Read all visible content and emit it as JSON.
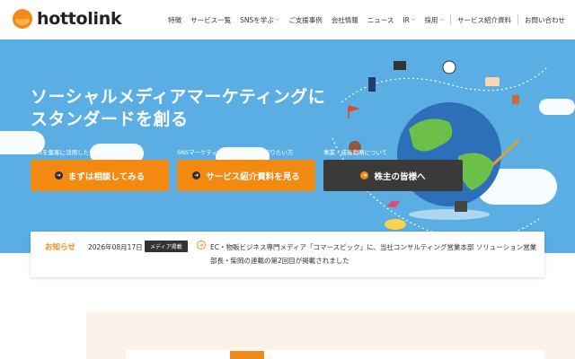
{
  "header": {
    "logo_text": "hottolink",
    "nav": [
      {
        "label": "特徴",
        "has_chevron": false
      },
      {
        "label": "サービス一覧",
        "has_chevron": false
      },
      {
        "label": "SNSを学ぶ",
        "has_chevron": true
      },
      {
        "label": "ご支援事例",
        "has_chevron": false
      },
      {
        "label": "会社情報",
        "has_chevron": false
      },
      {
        "label": "ニュース",
        "has_chevron": false
      },
      {
        "label": "IR",
        "has_chevron": true
      },
      {
        "label": "採用",
        "has_chevron": true
      },
      {
        "label": "サービス紹介資料",
        "has_chevron": false
      },
      {
        "label": "お問い合わせ",
        "has_chevron": false
      }
    ]
  },
  "hero": {
    "title_line1": "ソーシャルメディアマーケティングに",
    "title_line2": "スタンダードを創る",
    "ctas": [
      {
        "caption": "SNSを集客に活用したい方",
        "label": "まずは相談してみる",
        "style": "orange"
      },
      {
        "caption": "SNSマーケティング支援について知りたい方",
        "label": "サービス紹介資料を見る",
        "style": "orange"
      },
      {
        "caption": "事業・成長戦略について",
        "label": "株主の皆様へ",
        "style": "dark"
      }
    ]
  },
  "news": {
    "label": "お知らせ",
    "date": "2026年08月17日",
    "badge": "メディア掲載",
    "text": "EC・物販ビジネス専門メディア「コマースピック」に、当社コンサルティング営業本部 ソリューション営業部長・柴岡の連載の第2回目が掲載されました"
  },
  "colors": {
    "brand_orange": "#f08a1a",
    "hero_blue": "#5aaee3",
    "dark_button": "#3a3a3a"
  },
  "icons": [
    "chevron-down-icon",
    "arrow-right-icon",
    "globe-icon",
    "cloud-icon",
    "soccer-ball-icon",
    "clapperboard-icon",
    "guitar-icon",
    "cake-icon",
    "camera-icon",
    "heart-icon",
    "plant-icon",
    "flag-icon"
  ]
}
